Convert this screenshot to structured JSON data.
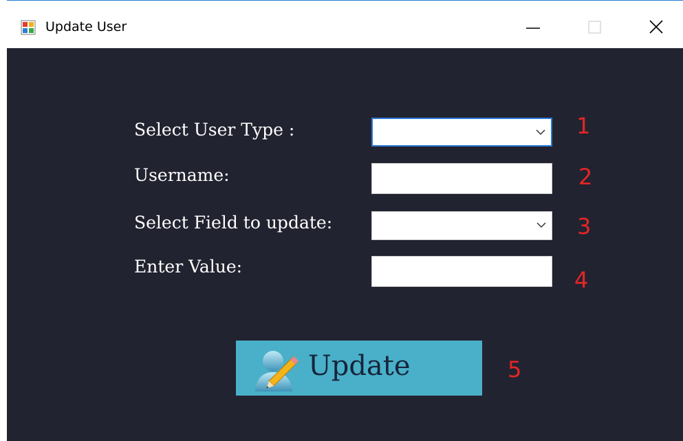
{
  "window": {
    "title": "Update User",
    "app_icon": "form-app-icon",
    "controls": {
      "minimize_icon": "minimize-icon",
      "maximize_icon": "maximize-icon",
      "close_icon": "close-icon"
    }
  },
  "form": {
    "user_type_label": "Select User Type :",
    "user_type_value": "",
    "username_label": "Username:",
    "username_value": "",
    "field_label": "Select Field to update:",
    "field_value": "",
    "value_label": "Enter Value:",
    "value_value": ""
  },
  "annotations": [
    "1",
    "2",
    "3",
    "4",
    "5"
  ],
  "update_button": {
    "label": "Update",
    "icon": "user-edit-icon"
  },
  "colors": {
    "background": "#222330",
    "button": "#4ab0c9",
    "annotation": "#e52626",
    "focus_border": "#2b7bd6"
  }
}
